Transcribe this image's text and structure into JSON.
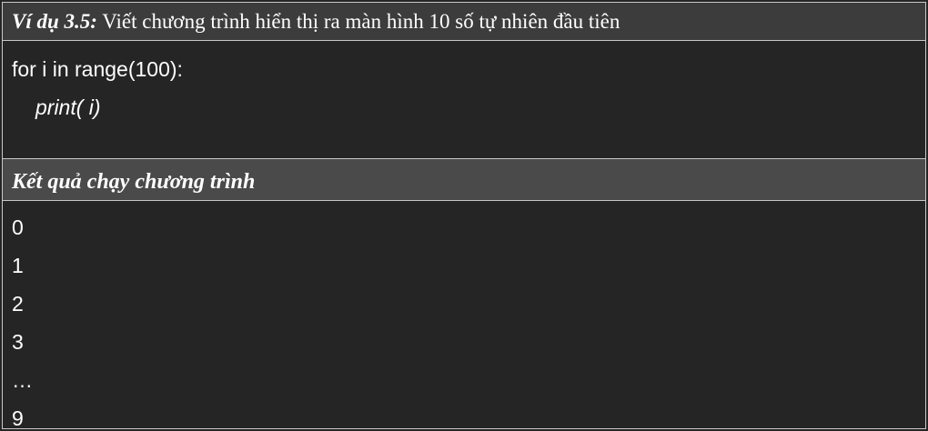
{
  "example": {
    "label": "Ví dụ 3.5:",
    "title": " Viết chương trình hiển thị ra màn hình 10 số tự nhiên đầu tiên"
  },
  "code": {
    "lines": [
      "for i in range(100):",
      "print( i)"
    ]
  },
  "result": {
    "heading": "Kết quả chạy chương trình",
    "output_lines": [
      "0",
      "1",
      "2",
      "3",
      "…",
      "9"
    ]
  }
}
